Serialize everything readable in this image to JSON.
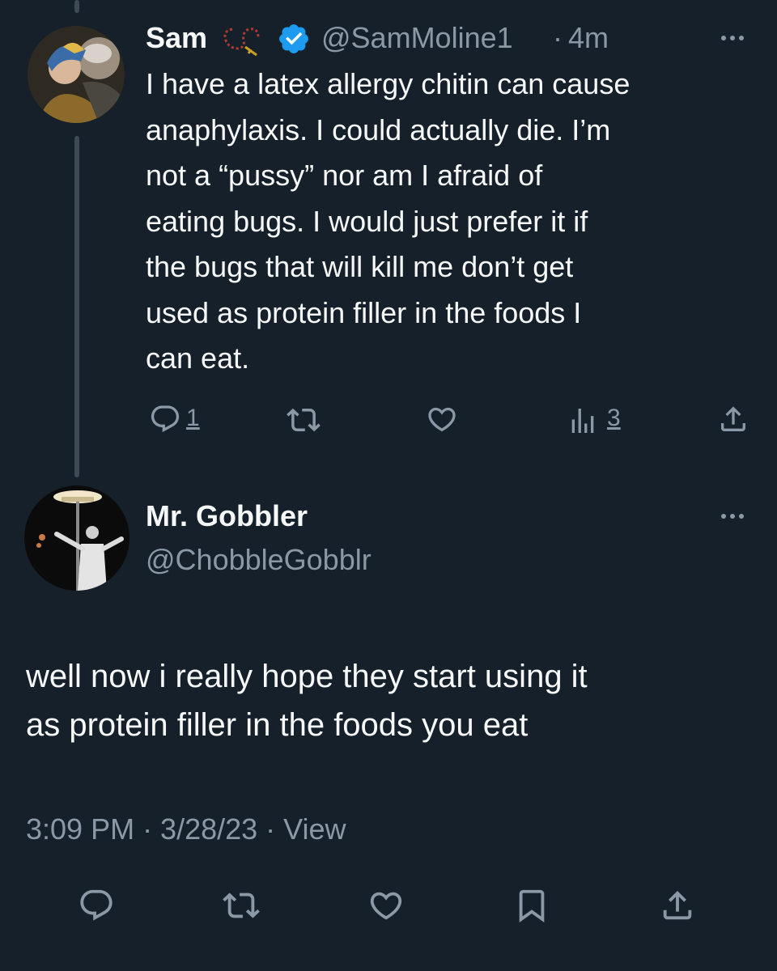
{
  "parent_tweet": {
    "display_name": "Sam",
    "handle": "@SamMoline1",
    "separator": "·",
    "time": "4m",
    "text_lines": [
      "I have a latex allergy chitin can cause",
      "anaphylaxis. I could actually die. I’m",
      "not a “pussy” nor am I afraid of",
      "eating bugs. I would just prefer it if",
      "the bugs that will kill me don’t get",
      "used as protein filler in the foods I",
      "can eat."
    ],
    "reply_count": "1",
    "view_count": "3",
    "badge_color": "#1d9bf0",
    "icons": [
      "rosary-icon",
      "verified-badge-icon",
      "more-icon",
      "reply-icon",
      "retweet-icon",
      "like-icon",
      "views-icon",
      "share-icon"
    ]
  },
  "reply_tweet": {
    "display_name": "Mr. Gobbler",
    "handle": "@ChobbleGobblr",
    "text_lines": [
      "well now i really hope they start using it",
      "as protein filler in the foods you eat"
    ],
    "timestamp": "3:09 PM · 3/28/23 · View",
    "icons": [
      "more-icon",
      "reply-icon",
      "retweet-icon",
      "like-icon",
      "bookmark-icon",
      "share-icon"
    ]
  },
  "colors": {
    "background": "#15202b",
    "text": "#f7f9f9",
    "secondary_text": "#8b98a5",
    "thread_line": "#3d4a56"
  }
}
